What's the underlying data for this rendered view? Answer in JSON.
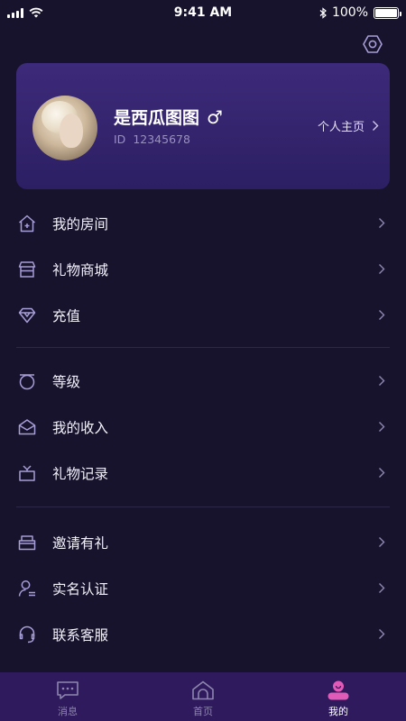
{
  "status_bar": {
    "time": "9:41 AM",
    "battery": "100%",
    "battery_level": 1.0,
    "icons": [
      "signal-icon",
      "wifi-icon",
      "bluetooth-icon",
      "battery-icon"
    ]
  },
  "settings": {
    "icon": "settings-icon"
  },
  "profile": {
    "name": "是西瓜图图",
    "gender_symbol": "♂",
    "id_label": "ID",
    "id_value": "12345678",
    "homepage_label": "个人主页",
    "avatar_icon": "avatar"
  },
  "menu_groups": [
    {
      "items": [
        {
          "label": "我的房间",
          "icon": "house-icon"
        },
        {
          "label": "礼物商城",
          "icon": "store-icon"
        },
        {
          "label": "充值",
          "icon": "diamond-icon"
        }
      ]
    },
    {
      "items": [
        {
          "label": "等级",
          "icon": "level-icon"
        },
        {
          "label": "我的收入",
          "icon": "envelope-icon"
        },
        {
          "label": "礼物记录",
          "icon": "gift-icon"
        }
      ]
    },
    {
      "items": [
        {
          "label": "邀请有礼",
          "icon": "invite-icon"
        },
        {
          "label": "实名认证",
          "icon": "user-verify-icon"
        },
        {
          "label": "联系客服",
          "icon": "headset-icon"
        }
      ]
    }
  ],
  "tabs": [
    {
      "label": "消息",
      "icon": "message-icon",
      "active": false
    },
    {
      "label": "首页",
      "icon": "home-icon",
      "active": false
    },
    {
      "label": "我的",
      "icon": "profile-icon",
      "active": true
    }
  ],
  "colors": {
    "background": "#18132d",
    "card": "#35256f",
    "icon_stroke": "#a69ed6",
    "tab_bar": "#2e1a5c",
    "active_tab": "#e05bb8"
  }
}
